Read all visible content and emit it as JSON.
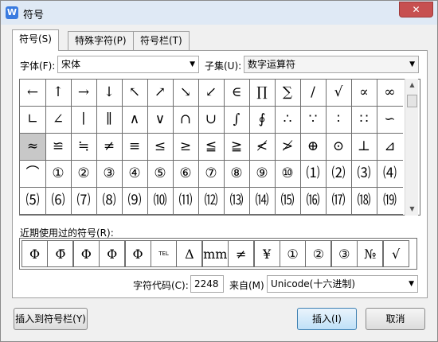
{
  "window": {
    "title": "符号",
    "app_icon": "W",
    "close_icon": "✕"
  },
  "tabs": [
    "符号(S)",
    "特殊字符(P)",
    "符号栏(T)"
  ],
  "font": {
    "label": "字体(F):",
    "value": "宋体"
  },
  "subset": {
    "label": "子集(U):",
    "value": "数字运算符"
  },
  "symbols": [
    [
      "←",
      "↑",
      "→",
      "↓",
      "↖",
      "↗",
      "↘",
      "↙",
      "∈",
      "∏",
      "∑",
      "∕",
      "√",
      "∝",
      "∞"
    ],
    [
      "∟",
      "∠",
      "∣",
      "∥",
      "∧",
      "∨",
      "∩",
      "∪",
      "∫",
      "∮",
      "∴",
      "∵",
      "∶",
      "∷",
      "∽"
    ],
    [
      "≈",
      "≌",
      "≒",
      "≠",
      "≡",
      "≤",
      "≥",
      "≦",
      "≧",
      "≮",
      "≯",
      "⊕",
      "⊙",
      "⊥",
      "⊿"
    ],
    [
      "⌒",
      "①",
      "②",
      "③",
      "④",
      "⑤",
      "⑥",
      "⑦",
      "⑧",
      "⑨",
      "⑩",
      "⑴",
      "⑵",
      "⑶",
      "⑷"
    ],
    [
      "⑸",
      "⑹",
      "⑺",
      "⑻",
      "⑼",
      "⑽",
      "⑾",
      "⑿",
      "⒀",
      "⒁",
      "⒂",
      "⒃",
      "⒄",
      "⒅",
      "⒆"
    ]
  ],
  "selected_symbol": "≈",
  "recent": {
    "label": "近期使用过的符号(R):",
    "items": [
      "Φ",
      "Φ̄",
      "Φ",
      "Φ",
      "Φ",
      "TEL",
      "Δ",
      "mm",
      "≠",
      "¥",
      "①",
      "②",
      "③",
      "№",
      "√"
    ]
  },
  "char_code": {
    "label": "字符代码(C):",
    "value": "2248"
  },
  "from": {
    "label": "来自(M)",
    "value": "Unicode(十六进制)"
  },
  "buttons": {
    "insert_to_bar": "插入到符号栏(Y)",
    "insert": "插入(I)",
    "cancel": "取消"
  }
}
